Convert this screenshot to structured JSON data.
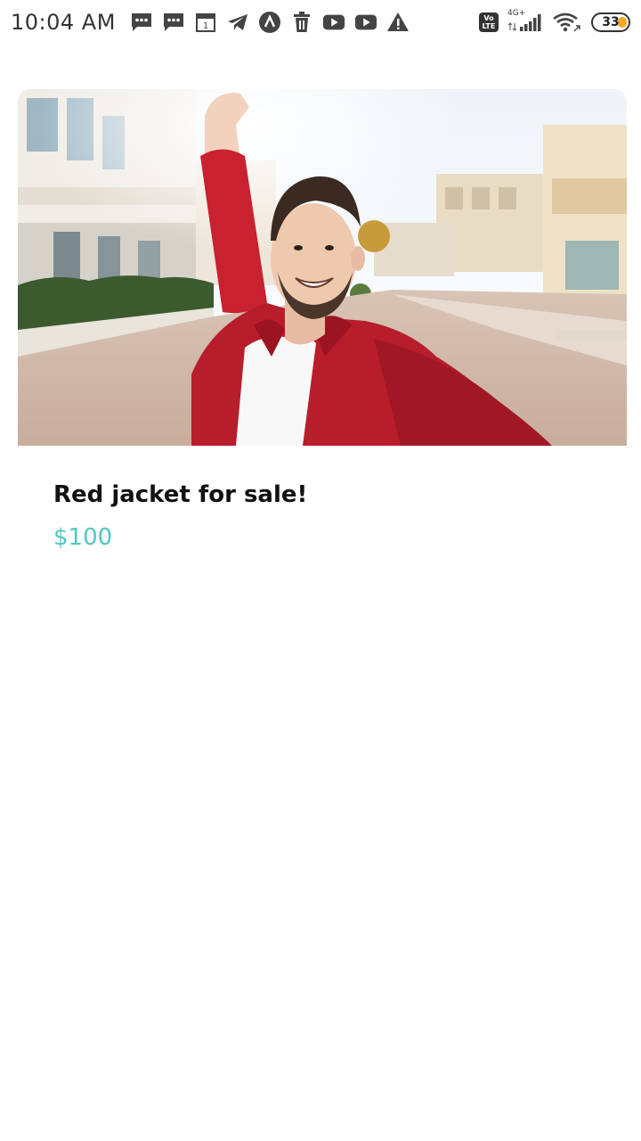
{
  "status_bar": {
    "time": "10:04 AM",
    "notification_icons": [
      "message-icon",
      "message-icon",
      "calendar-icon",
      "telegram-icon",
      "app-circle-icon",
      "trash-icon",
      "youtube-icon",
      "youtube-icon",
      "warning-icon"
    ],
    "volte_line1": "Vo",
    "volte_line2": "LTE",
    "network_type": "4G+",
    "battery_level": "33",
    "battery_fill_color": "#f5a623"
  },
  "product": {
    "title": "Red jacket for sale!",
    "price": "$100",
    "price_color": "#4fc8c0"
  }
}
